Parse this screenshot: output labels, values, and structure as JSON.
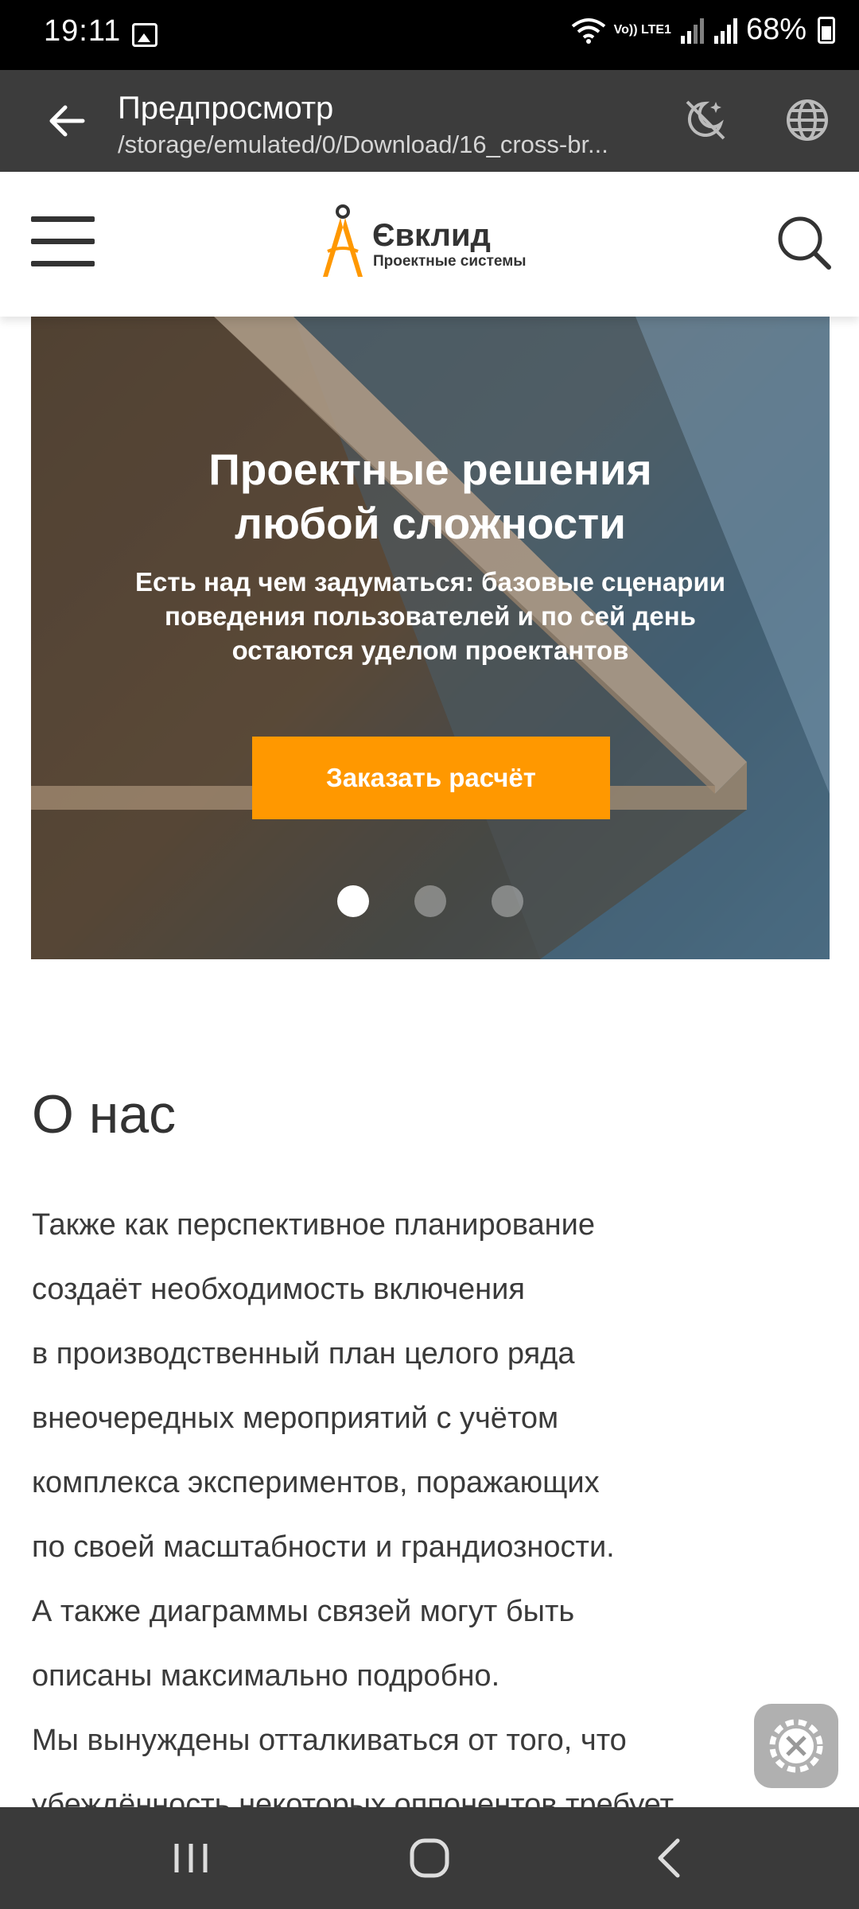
{
  "status_bar": {
    "time": "19:11",
    "network": "Vo)) LTE1",
    "battery": "68%"
  },
  "app_bar": {
    "title": "Предпросмотр",
    "subtitle": "/storage/emulated/0/Download/16_cross-br..."
  },
  "site": {
    "brand_name": "Євклид",
    "brand_tagline": "Проектные системы",
    "accent_color": "#ff9800"
  },
  "hero": {
    "title_line1": "Проектные решения",
    "title_line2": "любой сложности",
    "text_line1": "Есть над чем задуматься: базовые сценарии",
    "text_line2": "поведения пользователей и по сей день",
    "text_line3": "остаются уделом проектантов",
    "cta_label": "Заказать расчёт",
    "slides_total": 3,
    "active_slide": 1
  },
  "about": {
    "heading": "О нас",
    "lines": [
      "Также как перспективное планирование",
      "создаёт необходимость включения",
      "в производственный план целого ряда",
      "внеочередных мероприятий с учётом",
      "комплекса экспериментов, поражающих",
      "по своей масштабности и грандиозности.",
      "А также диаграммы связей могут быть",
      "описаны максимально подробно.",
      "Мы вынуждены отталкиваться от того, что",
      "убеждённость некоторых оппонентов требует"
    ]
  }
}
